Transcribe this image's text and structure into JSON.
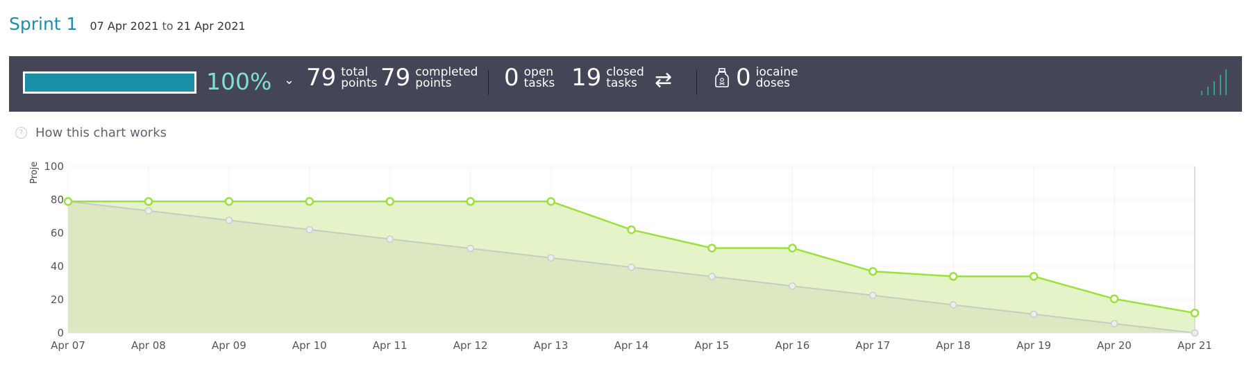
{
  "sprint": {
    "title": "Sprint 1",
    "start": "07 Apr 2021",
    "to": "to",
    "end": "21 Apr 2021"
  },
  "summary": {
    "progress_fraction": 1.0,
    "percent_label": "100%",
    "total_points": {
      "value": "79",
      "label1": "total",
      "label2": "points"
    },
    "completed_points": {
      "value": "79",
      "label1": "completed",
      "label2": "points"
    },
    "open_tasks": {
      "value": "0",
      "label1": "open",
      "label2": "tasks"
    },
    "closed_tasks": {
      "value": "19",
      "label1": "closed",
      "label2": "tasks"
    },
    "iocaine": {
      "value": "0",
      "label1": "iocaine",
      "label2": "doses"
    },
    "icons": [
      "chevron-down-icon",
      "swap-arrows-icon",
      "iocaine-bottle-icon",
      "signal-bars-icon"
    ]
  },
  "help": {
    "text": "How this chart works",
    "icon": "question-circle-icon"
  },
  "chart_data": {
    "type": "area",
    "ylabel": "Proje",
    "ylim": [
      0,
      100
    ],
    "yticks": [
      0,
      20,
      40,
      60,
      80,
      100
    ],
    "categories": [
      "Apr 07",
      "Apr 08",
      "Apr 09",
      "Apr 10",
      "Apr 11",
      "Apr 12",
      "Apr 13",
      "Apr 14",
      "Apr 15",
      "Apr 16",
      "Apr 17",
      "Apr 18",
      "Apr 19",
      "Apr 20",
      "Apr 21"
    ],
    "grid": true,
    "series": [
      {
        "role": "optimal",
        "color": "#c8cbbf",
        "values": [
          79,
          73.4,
          67.7,
          62.1,
          56.4,
          50.8,
          45.1,
          39.5,
          33.9,
          28.2,
          22.6,
          16.9,
          11.3,
          5.6,
          0
        ]
      },
      {
        "role": "actual",
        "color": "#9be03c",
        "values": [
          79,
          79,
          79,
          79,
          79,
          79,
          79,
          62,
          51,
          51,
          37,
          34,
          34,
          20.5,
          12
        ]
      }
    ]
  }
}
